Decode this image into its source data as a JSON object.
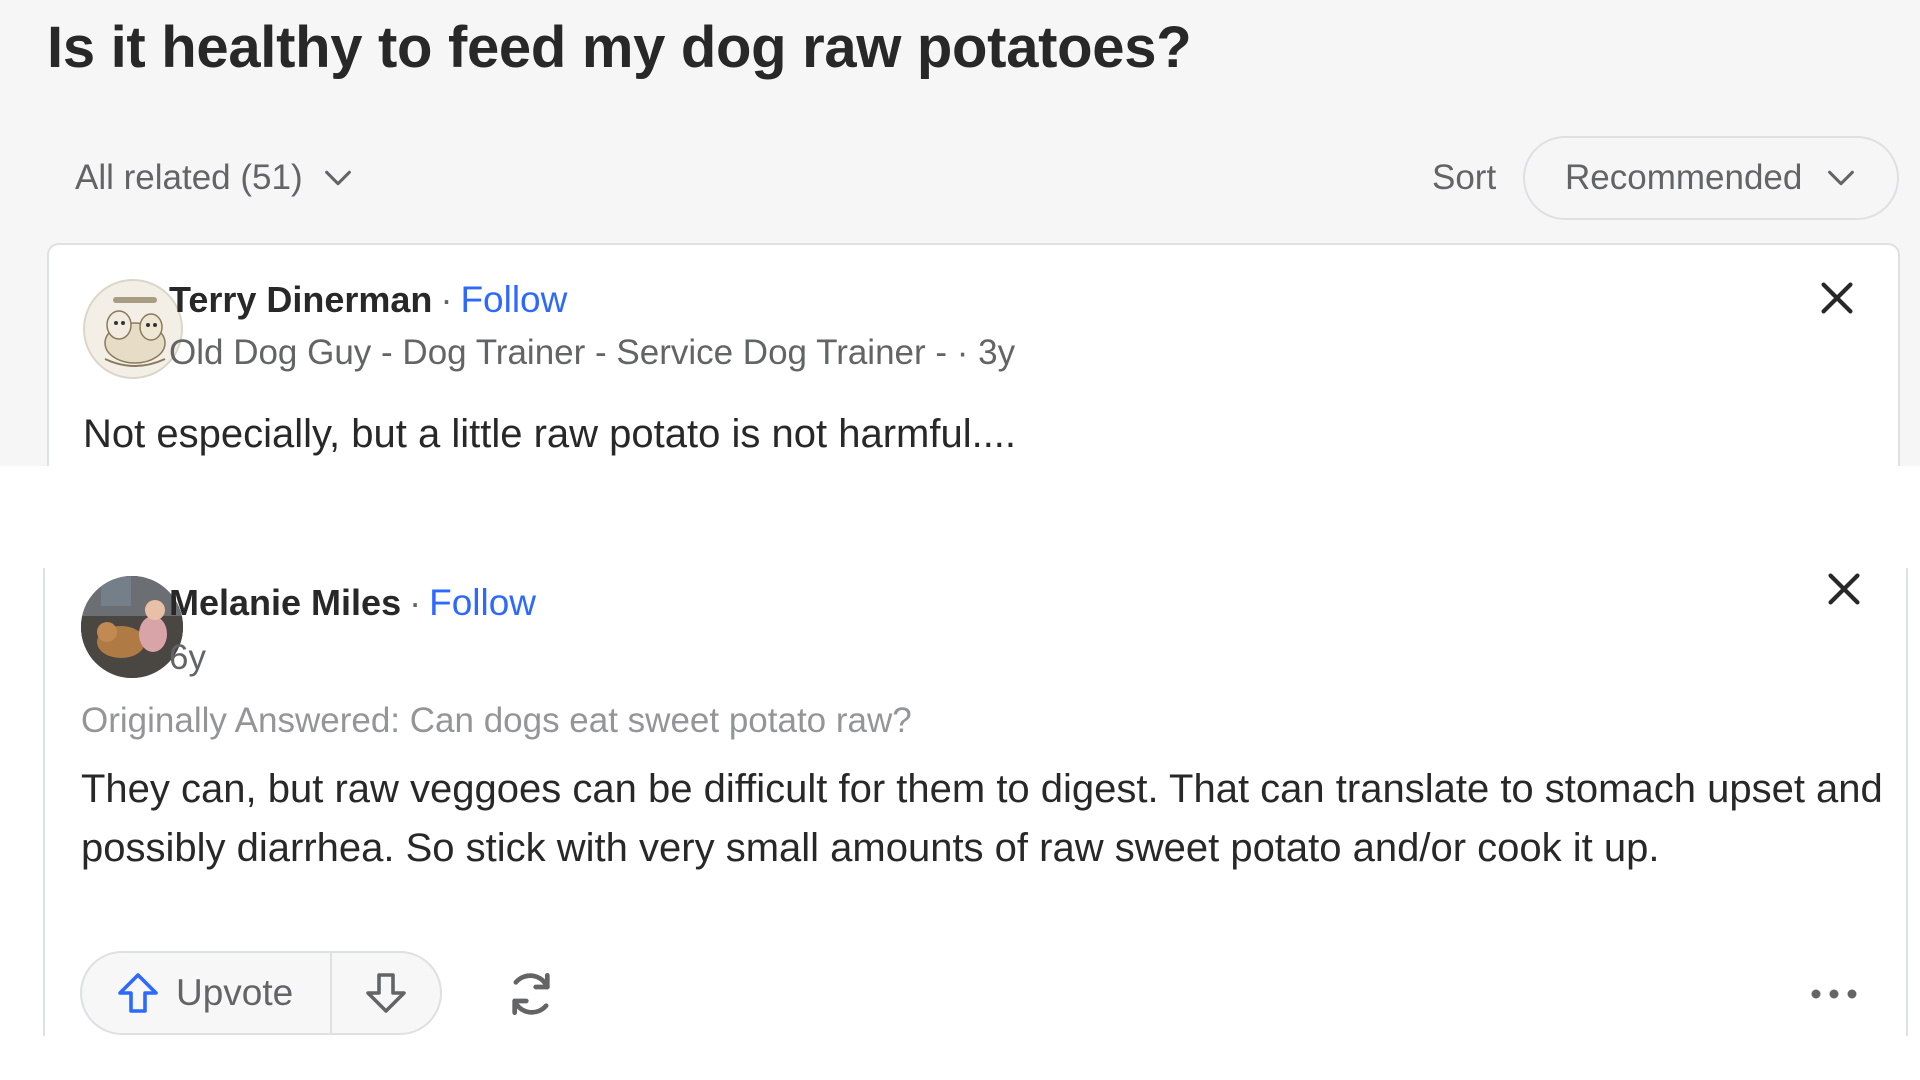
{
  "question": {
    "title": "Is it healthy to feed my dog raw potatoes?"
  },
  "filters": {
    "all_related_label": "All related (51)",
    "sort_label": "Sort",
    "sort_value": "Recommended"
  },
  "answers": [
    {
      "author": "Terry Dinerman",
      "separator": "·",
      "follow_label": "Follow",
      "credential": "Old Dog Guy - Dog Trainer - Service Dog Trainer - · 3y",
      "text": "Not especially, but a little raw potato is not harmful...."
    },
    {
      "author": "Melanie Miles",
      "separator": "·",
      "follow_label": "Follow",
      "credential": "6y",
      "originally_answered": "Originally Answered: Can dogs eat sweet potato raw?",
      "text": "They can, but raw veggoes can be difficult for them to digest. That can translate to stomach upset and possibly diarrhea. So stick with very small amounts of raw sweet potato and/or cook it up."
    }
  ],
  "actions": {
    "upvote_label": "Upvote"
  },
  "colors": {
    "accent_blue": "#2e69ff",
    "text_primary": "#282829",
    "text_secondary": "#636466",
    "border": "#dee0e1",
    "page_bg": "#f6f6f6"
  },
  "icons": {
    "all_related_chevron": "chevron-down-icon",
    "sort_chevron": "chevron-down-icon",
    "close": "close-icon",
    "upvote": "arrow-up-icon",
    "downvote": "arrow-down-icon",
    "share": "refresh-icon",
    "more": "more-dots-icon"
  }
}
